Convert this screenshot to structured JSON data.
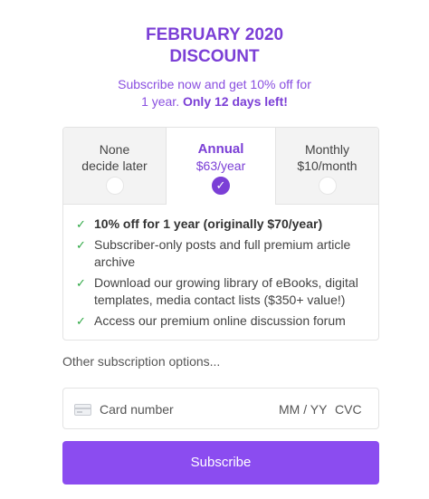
{
  "header": {
    "title_line1": "FEBRUARY 2020",
    "title_line2": "DISCOUNT",
    "subtitle_line1": "Subscribe now and get 10% off for",
    "subtitle_line2_plain": "1 year.",
    "subtitle_line2_bold": "Only 12 days left!"
  },
  "plans": [
    {
      "name": "None",
      "detail": "decide later",
      "selected": false
    },
    {
      "name": "Annual",
      "detail": "$63/year",
      "selected": true
    },
    {
      "name": "Monthly",
      "detail": "$10/month",
      "selected": false
    }
  ],
  "features": [
    {
      "text": "10% off for 1 year (originally $70/year)",
      "bold": true
    },
    {
      "text": "Subscriber-only posts and full premium article archive",
      "bold": false
    },
    {
      "text": "Download our growing library of eBooks, digital templates, media contact lists ($350+ value!)",
      "bold": false
    },
    {
      "text": "Access our premium online discussion forum",
      "bold": false
    }
  ],
  "check_glyph": "✓",
  "other_options_label": "Other subscription options...",
  "card": {
    "number_placeholder": "Card number",
    "expiry_placeholder": "MM / YY",
    "cvc_placeholder": "CVC"
  },
  "subscribe_label": "Subscribe",
  "colors": {
    "accent": "#7b3fd6",
    "button": "#8b4cf0",
    "check": "#2fa845"
  },
  "icons": {
    "card": "credit-card-icon",
    "check": "check-icon",
    "selected": "check-circle-icon"
  }
}
